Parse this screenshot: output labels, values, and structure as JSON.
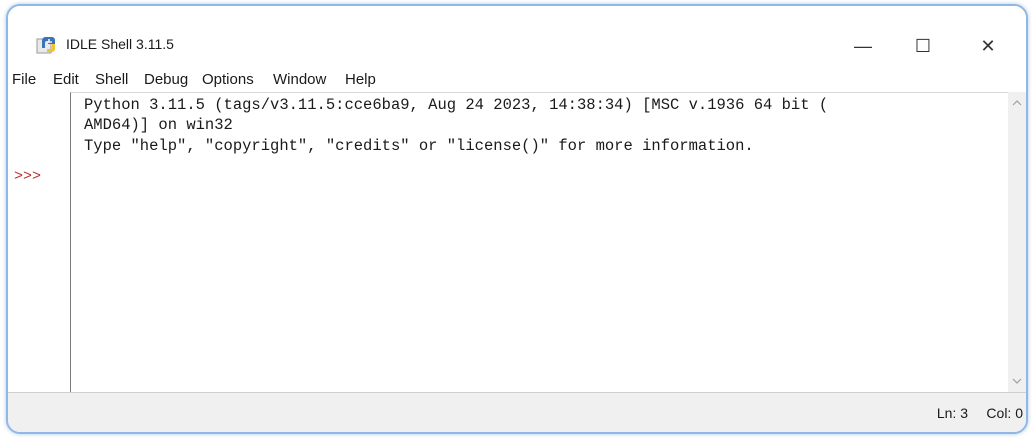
{
  "window": {
    "title": "IDLE Shell 3.11.5",
    "controls": {
      "minimize": "—",
      "maximize": "☐",
      "close": "✕"
    }
  },
  "menu": {
    "items": [
      "File",
      "Edit",
      "Shell",
      "Debug",
      "Options",
      "Window",
      "Help"
    ]
  },
  "shell": {
    "lines": [
      "Python 3.11.5 (tags/v3.11.5:cce6ba9, Aug 24 2023, 14:38:34) [MSC v.1936 64 bit (",
      "AMD64)] on win32",
      "Type \"help\", \"copyright\", \"credits\" or \"license()\" for more information."
    ],
    "prompt": ">>>"
  },
  "status": {
    "line": "Ln: 3",
    "col": "Col: 0"
  },
  "colors": {
    "prompt": "#c03030",
    "frame_border": "#8fb8e6"
  }
}
